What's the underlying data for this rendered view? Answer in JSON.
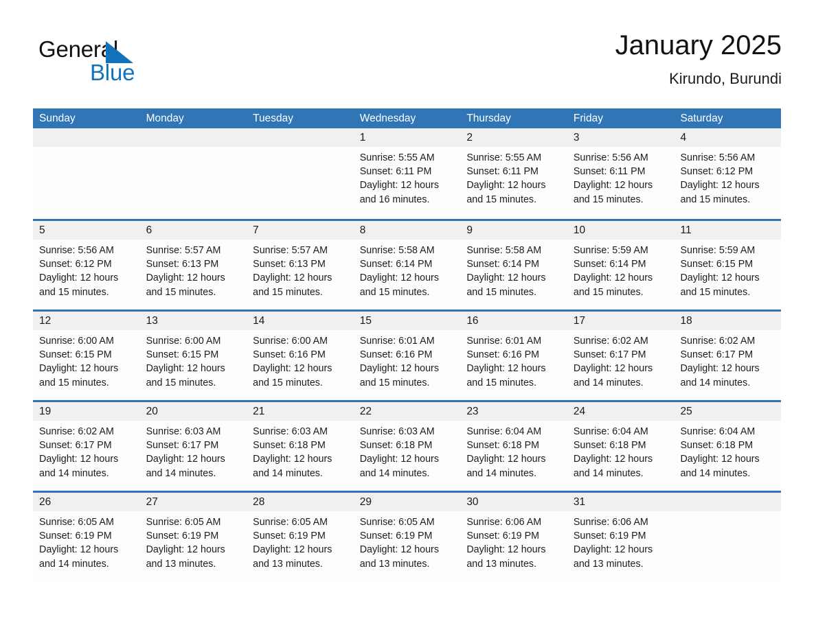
{
  "brand": {
    "name_part1": "General",
    "name_part2": "Blue",
    "accent_color": "#1273bd"
  },
  "header": {
    "title": "January 2025",
    "location": "Kirundo, Burundi"
  },
  "theme": {
    "header_blue": "#3075b5",
    "date_band_gray": "#f0f0f0",
    "cell_background": "#fdfdfd"
  },
  "weekdays": [
    "Sunday",
    "Monday",
    "Tuesday",
    "Wednesday",
    "Thursday",
    "Friday",
    "Saturday"
  ],
  "labels": {
    "sunrise_prefix": "Sunrise:",
    "sunset_prefix": "Sunset:",
    "daylight_prefix": "Daylight:"
  },
  "weeks": [
    [
      {
        "day": "",
        "line1": "",
        "line2": "",
        "line3": "",
        "line4": ""
      },
      {
        "day": "",
        "line1": "",
        "line2": "",
        "line3": "",
        "line4": ""
      },
      {
        "day": "",
        "line1": "",
        "line2": "",
        "line3": "",
        "line4": ""
      },
      {
        "day": "1",
        "line1": "Sunrise: 5:55 AM",
        "line2": "Sunset: 6:11 PM",
        "line3": "Daylight: 12 hours",
        "line4": "and 16 minutes."
      },
      {
        "day": "2",
        "line1": "Sunrise: 5:55 AM",
        "line2": "Sunset: 6:11 PM",
        "line3": "Daylight: 12 hours",
        "line4": "and 15 minutes."
      },
      {
        "day": "3",
        "line1": "Sunrise: 5:56 AM",
        "line2": "Sunset: 6:11 PM",
        "line3": "Daylight: 12 hours",
        "line4": "and 15 minutes."
      },
      {
        "day": "4",
        "line1": "Sunrise: 5:56 AM",
        "line2": "Sunset: 6:12 PM",
        "line3": "Daylight: 12 hours",
        "line4": "and 15 minutes."
      }
    ],
    [
      {
        "day": "5",
        "line1": "Sunrise: 5:56 AM",
        "line2": "Sunset: 6:12 PM",
        "line3": "Daylight: 12 hours",
        "line4": "and 15 minutes."
      },
      {
        "day": "6",
        "line1": "Sunrise: 5:57 AM",
        "line2": "Sunset: 6:13 PM",
        "line3": "Daylight: 12 hours",
        "line4": "and 15 minutes."
      },
      {
        "day": "7",
        "line1": "Sunrise: 5:57 AM",
        "line2": "Sunset: 6:13 PM",
        "line3": "Daylight: 12 hours",
        "line4": "and 15 minutes."
      },
      {
        "day": "8",
        "line1": "Sunrise: 5:58 AM",
        "line2": "Sunset: 6:14 PM",
        "line3": "Daylight: 12 hours",
        "line4": "and 15 minutes."
      },
      {
        "day": "9",
        "line1": "Sunrise: 5:58 AM",
        "line2": "Sunset: 6:14 PM",
        "line3": "Daylight: 12 hours",
        "line4": "and 15 minutes."
      },
      {
        "day": "10",
        "line1": "Sunrise: 5:59 AM",
        "line2": "Sunset: 6:14 PM",
        "line3": "Daylight: 12 hours",
        "line4": "and 15 minutes."
      },
      {
        "day": "11",
        "line1": "Sunrise: 5:59 AM",
        "line2": "Sunset: 6:15 PM",
        "line3": "Daylight: 12 hours",
        "line4": "and 15 minutes."
      }
    ],
    [
      {
        "day": "12",
        "line1": "Sunrise: 6:00 AM",
        "line2": "Sunset: 6:15 PM",
        "line3": "Daylight: 12 hours",
        "line4": "and 15 minutes."
      },
      {
        "day": "13",
        "line1": "Sunrise: 6:00 AM",
        "line2": "Sunset: 6:15 PM",
        "line3": "Daylight: 12 hours",
        "line4": "and 15 minutes."
      },
      {
        "day": "14",
        "line1": "Sunrise: 6:00 AM",
        "line2": "Sunset: 6:16 PM",
        "line3": "Daylight: 12 hours",
        "line4": "and 15 minutes."
      },
      {
        "day": "15",
        "line1": "Sunrise: 6:01 AM",
        "line2": "Sunset: 6:16 PM",
        "line3": "Daylight: 12 hours",
        "line4": "and 15 minutes."
      },
      {
        "day": "16",
        "line1": "Sunrise: 6:01 AM",
        "line2": "Sunset: 6:16 PM",
        "line3": "Daylight: 12 hours",
        "line4": "and 15 minutes."
      },
      {
        "day": "17",
        "line1": "Sunrise: 6:02 AM",
        "line2": "Sunset: 6:17 PM",
        "line3": "Daylight: 12 hours",
        "line4": "and 14 minutes."
      },
      {
        "day": "18",
        "line1": "Sunrise: 6:02 AM",
        "line2": "Sunset: 6:17 PM",
        "line3": "Daylight: 12 hours",
        "line4": "and 14 minutes."
      }
    ],
    [
      {
        "day": "19",
        "line1": "Sunrise: 6:02 AM",
        "line2": "Sunset: 6:17 PM",
        "line3": "Daylight: 12 hours",
        "line4": "and 14 minutes."
      },
      {
        "day": "20",
        "line1": "Sunrise: 6:03 AM",
        "line2": "Sunset: 6:17 PM",
        "line3": "Daylight: 12 hours",
        "line4": "and 14 minutes."
      },
      {
        "day": "21",
        "line1": "Sunrise: 6:03 AM",
        "line2": "Sunset: 6:18 PM",
        "line3": "Daylight: 12 hours",
        "line4": "and 14 minutes."
      },
      {
        "day": "22",
        "line1": "Sunrise: 6:03 AM",
        "line2": "Sunset: 6:18 PM",
        "line3": "Daylight: 12 hours",
        "line4": "and 14 minutes."
      },
      {
        "day": "23",
        "line1": "Sunrise: 6:04 AM",
        "line2": "Sunset: 6:18 PM",
        "line3": "Daylight: 12 hours",
        "line4": "and 14 minutes."
      },
      {
        "day": "24",
        "line1": "Sunrise: 6:04 AM",
        "line2": "Sunset: 6:18 PM",
        "line3": "Daylight: 12 hours",
        "line4": "and 14 minutes."
      },
      {
        "day": "25",
        "line1": "Sunrise: 6:04 AM",
        "line2": "Sunset: 6:18 PM",
        "line3": "Daylight: 12 hours",
        "line4": "and 14 minutes."
      }
    ],
    [
      {
        "day": "26",
        "line1": "Sunrise: 6:05 AM",
        "line2": "Sunset: 6:19 PM",
        "line3": "Daylight: 12 hours",
        "line4": "and 14 minutes."
      },
      {
        "day": "27",
        "line1": "Sunrise: 6:05 AM",
        "line2": "Sunset: 6:19 PM",
        "line3": "Daylight: 12 hours",
        "line4": "and 13 minutes."
      },
      {
        "day": "28",
        "line1": "Sunrise: 6:05 AM",
        "line2": "Sunset: 6:19 PM",
        "line3": "Daylight: 12 hours",
        "line4": "and 13 minutes."
      },
      {
        "day": "29",
        "line1": "Sunrise: 6:05 AM",
        "line2": "Sunset: 6:19 PM",
        "line3": "Daylight: 12 hours",
        "line4": "and 13 minutes."
      },
      {
        "day": "30",
        "line1": "Sunrise: 6:06 AM",
        "line2": "Sunset: 6:19 PM",
        "line3": "Daylight: 12 hours",
        "line4": "and 13 minutes."
      },
      {
        "day": "31",
        "line1": "Sunrise: 6:06 AM",
        "line2": "Sunset: 6:19 PM",
        "line3": "Daylight: 12 hours",
        "line4": "and 13 minutes."
      },
      {
        "day": "",
        "line1": "",
        "line2": "",
        "line3": "",
        "line4": ""
      }
    ]
  ]
}
